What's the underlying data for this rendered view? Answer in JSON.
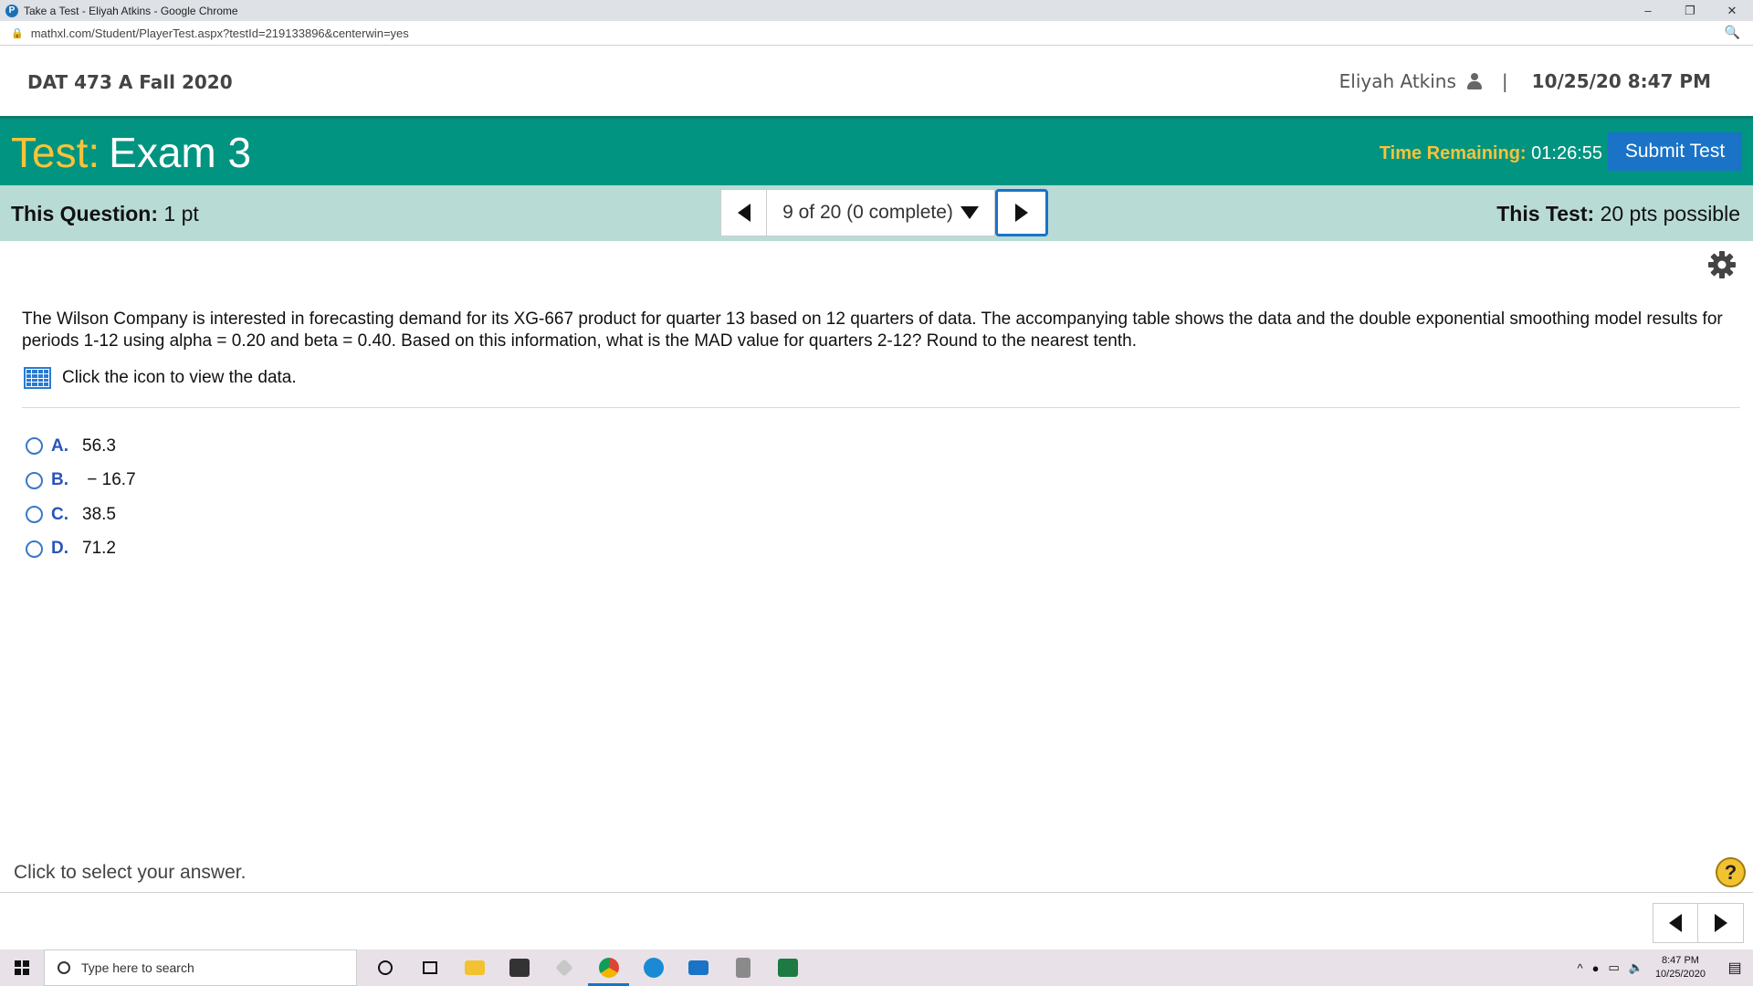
{
  "browser": {
    "title": "Take a Test - Eliyah Atkins - Google Chrome",
    "url": "mathxl.com/Student/PlayerTest.aspx?testId=219133896&centerwin=yes",
    "minimize": "–",
    "restore": "❐",
    "close": "✕"
  },
  "header": {
    "course": "DAT 473 A Fall 2020",
    "user": "Eliyah Atkins",
    "separator": "|",
    "datetime": "10/25/20 8:47 PM"
  },
  "banner": {
    "test_label": "Test:",
    "test_name": "Exam 3",
    "time_label": "Time Remaining:",
    "time_value": "01:26:55",
    "submit_label": "Submit Test"
  },
  "question_bar": {
    "this_question_label": "This Question:",
    "this_question_value": "1 pt",
    "progress": "9 of 20 (0 complete)",
    "this_test_label": "This Test:",
    "this_test_value": "20 pts possible"
  },
  "question": {
    "text": "The Wilson Company is interested in forecasting demand for its XG-667 product for quarter 13 based on 12 quarters of data. The accompanying table shows the data and the double exponential smoothing model results for periods 1-12 using alpha = 0.20 and beta = 0.40. Based on this information, what is the MAD value for quarters 2-12? Round to the nearest tenth.",
    "data_link": "Click the icon to view the data.",
    "choices": [
      {
        "letter": "A.",
        "value": "56.3"
      },
      {
        "letter": "B.",
        "value": " − 16.7"
      },
      {
        "letter": "C.",
        "value": "38.5"
      },
      {
        "letter": "D.",
        "value": "71.2"
      }
    ]
  },
  "footer": {
    "hint": "Click to select your answer.",
    "help": "?"
  },
  "taskbar": {
    "search_placeholder": "Type here to search",
    "time": "8:47 PM",
    "date": "10/25/2020"
  },
  "colors": {
    "banner": "#009481",
    "accent_yellow": "#f7c33b",
    "question_bar": "#b9dbd6",
    "submit": "#1a73c7"
  }
}
